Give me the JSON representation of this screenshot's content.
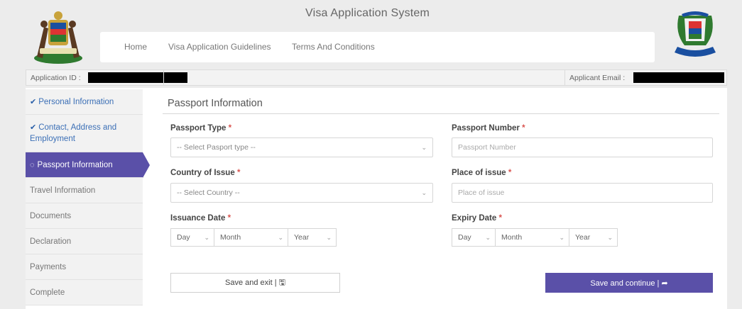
{
  "header": {
    "title": "Visa Application System",
    "nav": {
      "home": "Home",
      "guidelines": "Visa Application Guidelines",
      "terms": "Terms And Conditions"
    }
  },
  "infobar": {
    "application_id_label": "Application ID :",
    "applicant_email_label": "Applicant Email :"
  },
  "sidebar": {
    "items": [
      {
        "label": "Personal Information",
        "state": "done"
      },
      {
        "label": "Contact, Address and Employment",
        "state": "done"
      },
      {
        "label": "Passport Information",
        "state": "active"
      },
      {
        "label": "Travel Information",
        "state": "pending"
      },
      {
        "label": "Documents",
        "state": "pending"
      },
      {
        "label": "Declaration",
        "state": "pending"
      },
      {
        "label": "Payments",
        "state": "pending"
      },
      {
        "label": "Complete",
        "state": "pending"
      }
    ]
  },
  "form": {
    "title": "Passport Information",
    "passport_type": {
      "label": "Passport Type",
      "required": "*",
      "value": "-- Select Pasport type --"
    },
    "passport_number": {
      "label": "Passport Number",
      "required": "*",
      "placeholder": "Passport Number"
    },
    "country_of_issue": {
      "label": "Country of Issue",
      "required": "*",
      "value": "-- Select Country --"
    },
    "place_of_issue": {
      "label": "Place of issue",
      "required": "*",
      "placeholder": "Place of issue"
    },
    "issuance_date": {
      "label": "Issuance Date",
      "required": "*",
      "day": "Day",
      "month": "Month",
      "year": "Year"
    },
    "expiry_date": {
      "label": "Expiry Date",
      "required": "*",
      "day": "Day",
      "month": "Month",
      "year": "Year"
    }
  },
  "buttons": {
    "save_exit": "Save and exit | 🖫",
    "save_continue": "Save and continue | ➦"
  },
  "colors": {
    "accent": "#5a50a8",
    "done_link": "#3b6fb6",
    "required": "#d9534f"
  }
}
